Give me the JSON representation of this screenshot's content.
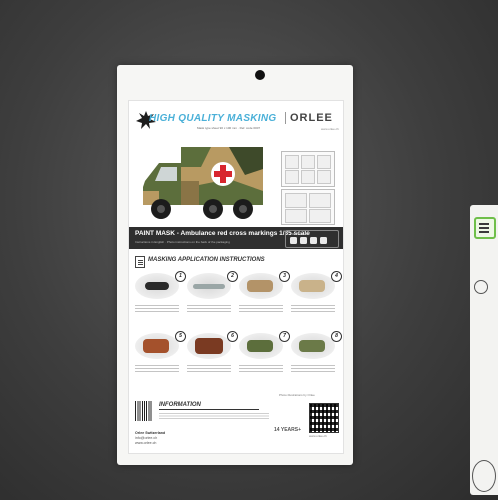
{
  "package": {
    "header": {
      "title": "HIGH QUALITY MASKING",
      "subtitle": "Mask type sheet 90 x 100 mm · Ref. code 0007",
      "brand": "ORLEE",
      "brand_web": "www.orlee.ch"
    },
    "banner": {
      "title": "PAINT MASK - Ambulance red cross markings 1/35 scale",
      "subtitle": "Instructions in English · Photo instructions on the back of the packaging",
      "follow_label": "FOLLOW US"
    },
    "instructions": {
      "title": "MASKING APPLICATION INSTRUCTIONS",
      "steps": [
        "1",
        "2",
        "3",
        "4",
        "5",
        "6",
        "7",
        "8"
      ],
      "credit": "Photo illustrations by Orlee"
    },
    "info": {
      "title": "INFORMATION",
      "age": "14 YEARS+",
      "address": [
        "Orlee Switzerland",
        "info@orlee.ch",
        "www.orlee.ch"
      ],
      "qr_url": "www.orlee.ch"
    }
  },
  "colors": {
    "title_blue": "#4ab0d8",
    "banner_dark": "#2f2f2f",
    "cross_red": "#d8262e",
    "camo_green": "#5c6e3c",
    "camo_tan": "#b89a62",
    "side_accent": "#6fbf4a"
  },
  "icons": [
    "instructions-icon",
    "red-cross-icon",
    "social-icons",
    "qr-code",
    "barcode"
  ]
}
